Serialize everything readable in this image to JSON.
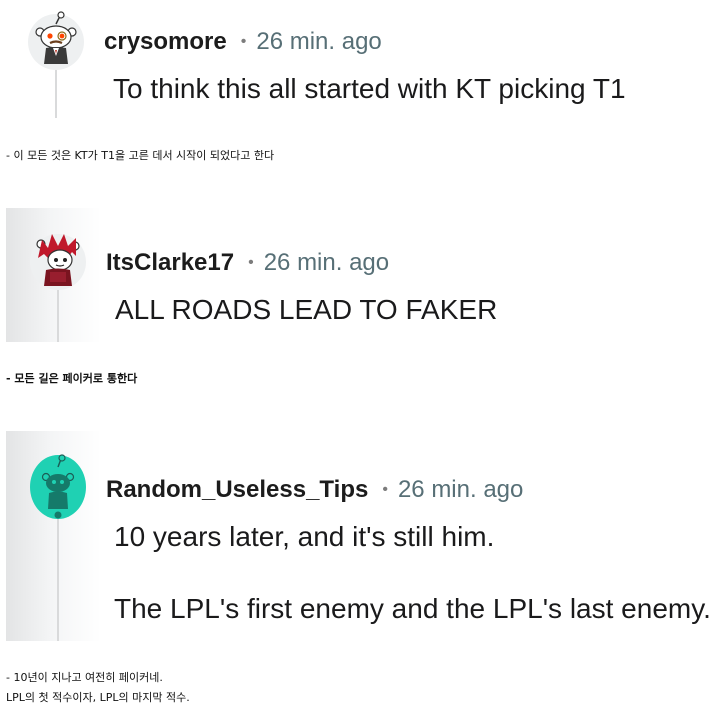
{
  "comments": [
    {
      "username": "crysomore",
      "separator": "•",
      "time": "26 min. ago",
      "lines": [
        "To think this all started with KT picking T1"
      ],
      "avatar_icon": "snoo-avatar-monocle-icon",
      "translation": [
        "- 이 모든 것은 KT가 T1을 고른 데서 시작이 되었다고 한다"
      ]
    },
    {
      "username": "ItsClarke17",
      "separator": "•",
      "time": "26 min. ago",
      "lines": [
        "ALL ROADS LEAD TO FAKER"
      ],
      "avatar_icon": "snoo-avatar-red-hair-icon",
      "translation": [
        "- 모든 길은 페이커로 통한다"
      ]
    },
    {
      "username": "Random_Useless_Tips",
      "separator": "•",
      "time": "26 min. ago",
      "lines": [
        "10 years later, and it's still him.",
        "The LPL's first enemy and the LPL's last enemy."
      ],
      "avatar_icon": "snoo-avatar-teal-icon",
      "translation": [
        "- 10년이 지나고 여전히 페이커네.",
        "LPL의 첫 적수이자, LPL의 마지막 적수."
      ]
    }
  ],
  "colors": {
    "username": "#1c1c1c",
    "time": "#576f76",
    "text": "#1a1a1b",
    "thread_line": "#d9dadb",
    "teal_avatar": "#1fd1b3"
  }
}
